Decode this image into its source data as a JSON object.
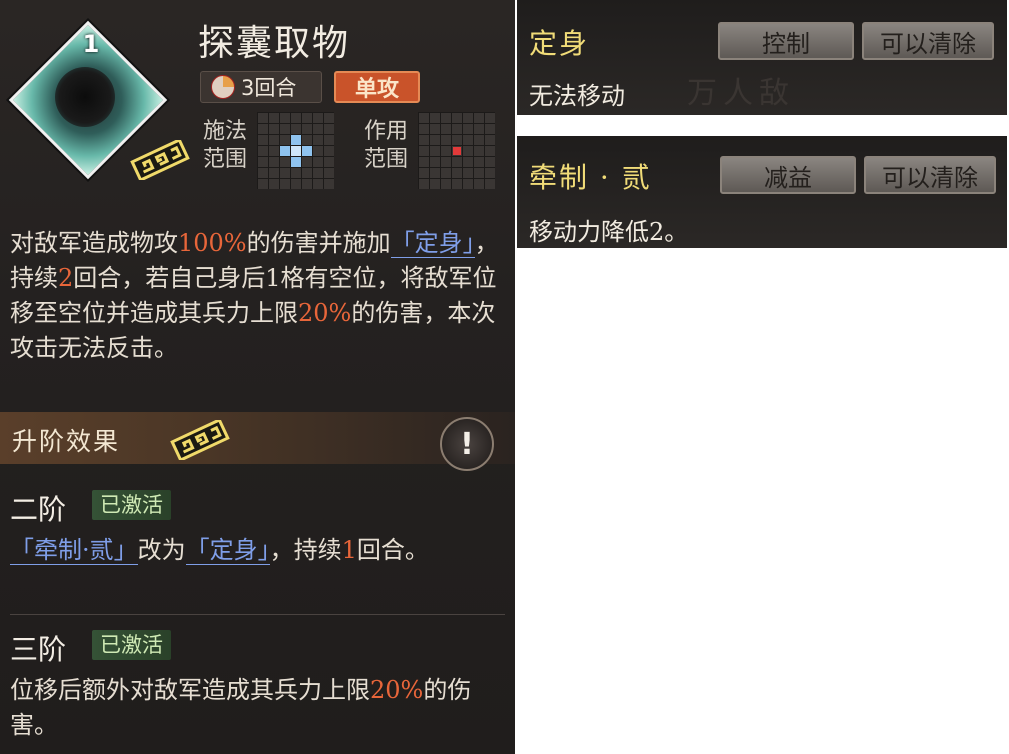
{
  "skill": {
    "level": "1",
    "name": "探囊取物",
    "rounds_tag": "3回合",
    "type_tag": "单攻",
    "cast_range_label_1": "施法",
    "cast_range_label_2": "范围",
    "effect_range_label_1": "作用",
    "effect_range_label_2": "范围",
    "colors": {
      "cast_cell": "#8fc3ef",
      "effect_cell": "#e23a3a",
      "highlight": "#e8663a",
      "keyword": "#7f9ee8"
    }
  },
  "description": {
    "p1": "对敌军造成物攻",
    "v1": "100%",
    "p2": "的伤害并施加",
    "kw1": "「定身」",
    "p3": "，持续",
    "v2": "2",
    "p4": "回合，若自己身后1格有空位，将敌军位移至空位并造成其兵力上限",
    "v3": "20%",
    "p5": "的伤害，本次攻击无法反击。"
  },
  "upgrade": {
    "title": "升阶效果",
    "warn_icon": "!",
    "tier2": {
      "title": "二阶",
      "badge": "已激活",
      "kw1": "「牵制·贰」",
      "t1": "改为",
      "kw2": "「定身」",
      "t2": "，持续",
      "v1": "1",
      "t3": "回合。"
    },
    "tier3": {
      "title": "三阶",
      "badge": "已激活",
      "t1": "位移后额外对敌军造成其兵力上限",
      "v1": "20%",
      "t2": "的伤害。"
    }
  },
  "tooltips": [
    {
      "name": "定身",
      "category": "控制",
      "clear": "可以清除",
      "desc": "无法移动",
      "watermark": "万人敌"
    },
    {
      "name": "牵制 · 贰",
      "category": "减益",
      "clear": "可以清除",
      "desc": "移动力降低2。"
    }
  ]
}
